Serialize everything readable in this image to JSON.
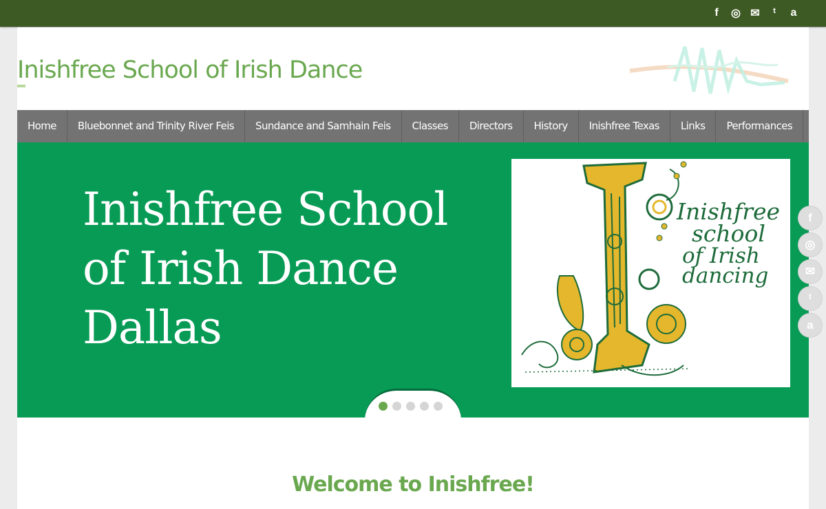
{
  "site": {
    "title": "Inishfree School of Irish Dance"
  },
  "social": [
    {
      "name": "facebook-icon",
      "glyph": "f"
    },
    {
      "name": "instagram-icon",
      "glyph": "◎"
    },
    {
      "name": "mail-icon",
      "glyph": "✉"
    },
    {
      "name": "twitter-icon",
      "glyph": "ᵗ"
    },
    {
      "name": "amazon-icon",
      "glyph": "a"
    }
  ],
  "nav": {
    "items": [
      "Home",
      "Bluebonnet and Trinity River Feis",
      "Sundance and Samhain Feis",
      "Classes",
      "Directors",
      "History",
      "Inishfree Texas",
      "Links",
      "Performances"
    ]
  },
  "hero": {
    "lines": [
      "Inishfree School",
      "of Irish Dance",
      "Dallas"
    ],
    "image_text": [
      "Inishfree",
      "school",
      "of Irish",
      "dancing"
    ],
    "slide_count": 5,
    "active_slide": 1
  },
  "welcome": {
    "heading": "Welcome to Inishfree!"
  },
  "colors": {
    "topbar": "#3d5a24",
    "accent_green": "#6aa84f",
    "hero_green": "#079b55",
    "nav_gray": "#737373"
  }
}
